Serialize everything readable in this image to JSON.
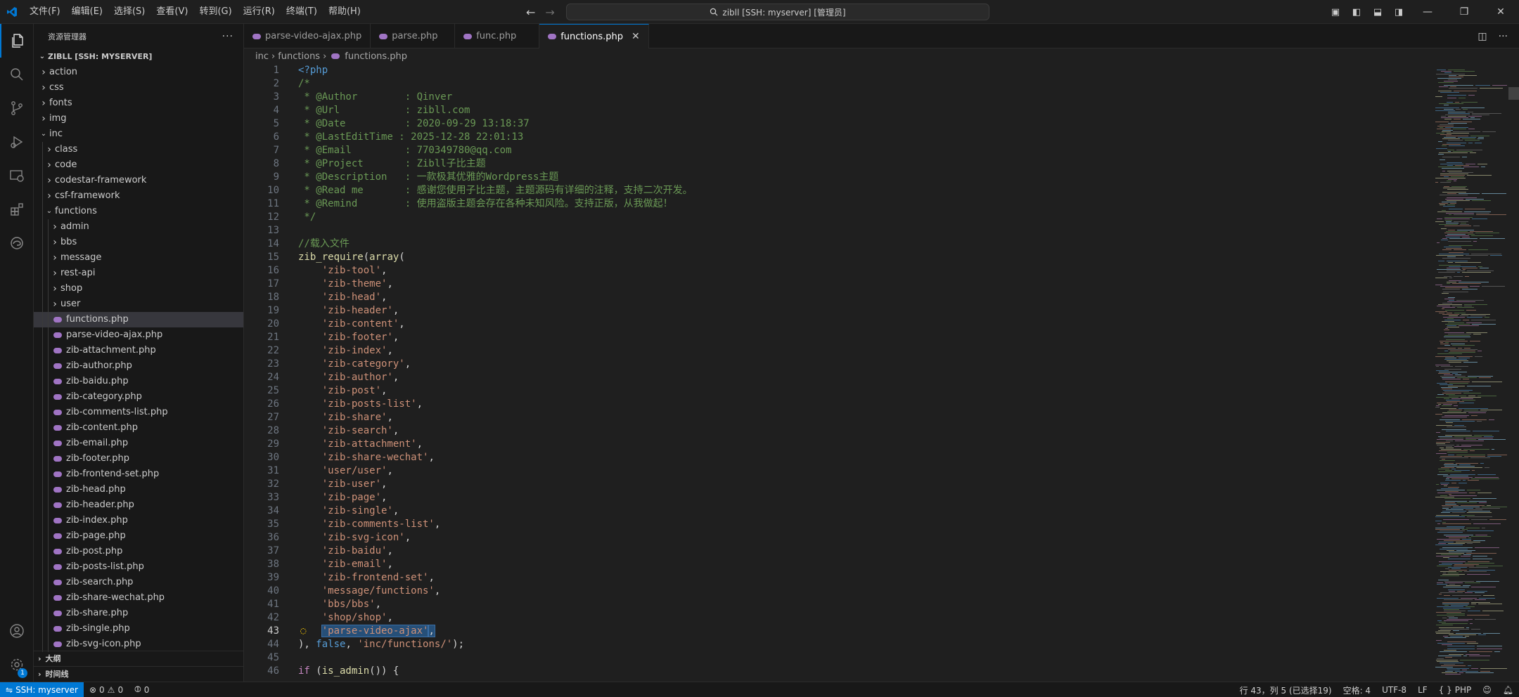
{
  "titlebar": {
    "menu": [
      "文件(F)",
      "编辑(E)",
      "选择(S)",
      "查看(V)",
      "转到(G)",
      "运行(R)",
      "终端(T)",
      "帮助(H)"
    ],
    "command_center": "zibll [SSH: myserver] [管理员]",
    "back_arrow": "←",
    "forward_arrow": "→"
  },
  "sidebar": {
    "header": "资源管理器",
    "more": "···",
    "workspace": "ZIBLL [SSH: MYSERVER]",
    "tree": [
      {
        "label": "action",
        "type": "folder",
        "depth": 0,
        "open": false
      },
      {
        "label": "css",
        "type": "folder",
        "depth": 0,
        "open": false
      },
      {
        "label": "fonts",
        "type": "folder",
        "depth": 0,
        "open": false
      },
      {
        "label": "img",
        "type": "folder",
        "depth": 0,
        "open": false
      },
      {
        "label": "inc",
        "type": "folder",
        "depth": 0,
        "open": true
      },
      {
        "label": "class",
        "type": "folder",
        "depth": 1,
        "open": false
      },
      {
        "label": "code",
        "type": "folder",
        "depth": 1,
        "open": false
      },
      {
        "label": "codestar-framework",
        "type": "folder",
        "depth": 1,
        "open": false
      },
      {
        "label": "csf-framework",
        "type": "folder",
        "depth": 1,
        "open": false
      },
      {
        "label": "functions",
        "type": "folder",
        "depth": 1,
        "open": true
      },
      {
        "label": "admin",
        "type": "folder",
        "depth": 2,
        "open": false
      },
      {
        "label": "bbs",
        "type": "folder",
        "depth": 2,
        "open": false
      },
      {
        "label": "message",
        "type": "folder",
        "depth": 2,
        "open": false
      },
      {
        "label": "rest-api",
        "type": "folder",
        "depth": 2,
        "open": false
      },
      {
        "label": "shop",
        "type": "folder",
        "depth": 2,
        "open": false
      },
      {
        "label": "user",
        "type": "folder",
        "depth": 2,
        "open": false
      },
      {
        "label": "functions.php",
        "type": "php",
        "depth": 2,
        "selected": true
      },
      {
        "label": "parse-video-ajax.php",
        "type": "php",
        "depth": 2
      },
      {
        "label": "zib-attachment.php",
        "type": "php",
        "depth": 2
      },
      {
        "label": "zib-author.php",
        "type": "php",
        "depth": 2
      },
      {
        "label": "zib-baidu.php",
        "type": "php",
        "depth": 2
      },
      {
        "label": "zib-category.php",
        "type": "php",
        "depth": 2
      },
      {
        "label": "zib-comments-list.php",
        "type": "php",
        "depth": 2
      },
      {
        "label": "zib-content.php",
        "type": "php",
        "depth": 2
      },
      {
        "label": "zib-email.php",
        "type": "php",
        "depth": 2
      },
      {
        "label": "zib-footer.php",
        "type": "php",
        "depth": 2
      },
      {
        "label": "zib-frontend-set.php",
        "type": "php",
        "depth": 2
      },
      {
        "label": "zib-head.php",
        "type": "php",
        "depth": 2
      },
      {
        "label": "zib-header.php",
        "type": "php",
        "depth": 2
      },
      {
        "label": "zib-index.php",
        "type": "php",
        "depth": 2
      },
      {
        "label": "zib-page.php",
        "type": "php",
        "depth": 2
      },
      {
        "label": "zib-post.php",
        "type": "php",
        "depth": 2
      },
      {
        "label": "zib-posts-list.php",
        "type": "php",
        "depth": 2
      },
      {
        "label": "zib-search.php",
        "type": "php",
        "depth": 2
      },
      {
        "label": "zib-share-wechat.php",
        "type": "php",
        "depth": 2
      },
      {
        "label": "zib-share.php",
        "type": "php",
        "depth": 2
      },
      {
        "label": "zib-single.php",
        "type": "php",
        "depth": 2
      },
      {
        "label": "zib-svg-icon.php",
        "type": "php",
        "depth": 2
      }
    ],
    "outline": "大纲",
    "timeline": "时间线"
  },
  "activity_badge": "1",
  "tabs": [
    {
      "label": "parse-video-ajax.php",
      "active": false
    },
    {
      "label": "parse.php",
      "active": false
    },
    {
      "label": "func.php",
      "active": false
    },
    {
      "label": "functions.php",
      "active": true
    }
  ],
  "breadcrumb": [
    "inc",
    "functions",
    "functions.php"
  ],
  "code_lines": [
    [
      [
        "c-tag",
        "<?php"
      ]
    ],
    [
      [
        "c-comment",
        "/*"
      ]
    ],
    [
      [
        "c-comment",
        " * @Author        : Qinver"
      ]
    ],
    [
      [
        "c-comment",
        " * @Url           : zibll.com"
      ]
    ],
    [
      [
        "c-comment",
        " * @Date          : 2020-09-29 13:18:37"
      ]
    ],
    [
      [
        "c-comment",
        " * @LastEditTime : 2025-12-28 22:01:13"
      ]
    ],
    [
      [
        "c-comment",
        " * @Email         : 770349780@qq.com"
      ]
    ],
    [
      [
        "c-comment",
        " * @Project       : Zibll子比主题"
      ]
    ],
    [
      [
        "c-comment",
        " * @Description   : 一款极其优雅的Wordpress主题"
      ]
    ],
    [
      [
        "c-comment",
        " * @Read me       : 感谢您使用子比主题，主题源码有详细的注释，支持二次开发。"
      ]
    ],
    [
      [
        "c-comment",
        " * @Remind        : 使用盗版主题会存在各种未知风险。支持正版，从我做起！"
      ]
    ],
    [
      [
        "c-comment",
        " */"
      ]
    ],
    [
      [
        "c-plain",
        ""
      ]
    ],
    [
      [
        "c-comment",
        "//载入文件"
      ]
    ],
    [
      [
        "c-fn",
        "zib_require"
      ],
      [
        "c-plain",
        "("
      ],
      [
        "c-fn",
        "array"
      ],
      [
        "c-plain",
        "("
      ]
    ],
    [
      [
        "c-plain",
        "    "
      ],
      [
        "c-str",
        "'zib-tool'"
      ],
      [
        "c-plain",
        ","
      ]
    ],
    [
      [
        "c-plain",
        "    "
      ],
      [
        "c-str",
        "'zib-theme'"
      ],
      [
        "c-plain",
        ","
      ]
    ],
    [
      [
        "c-plain",
        "    "
      ],
      [
        "c-str",
        "'zib-head'"
      ],
      [
        "c-plain",
        ","
      ]
    ],
    [
      [
        "c-plain",
        "    "
      ],
      [
        "c-str",
        "'zib-header'"
      ],
      [
        "c-plain",
        ","
      ]
    ],
    [
      [
        "c-plain",
        "    "
      ],
      [
        "c-str",
        "'zib-content'"
      ],
      [
        "c-plain",
        ","
      ]
    ],
    [
      [
        "c-plain",
        "    "
      ],
      [
        "c-str",
        "'zib-footer'"
      ],
      [
        "c-plain",
        ","
      ]
    ],
    [
      [
        "c-plain",
        "    "
      ],
      [
        "c-str",
        "'zib-index'"
      ],
      [
        "c-plain",
        ","
      ]
    ],
    [
      [
        "c-plain",
        "    "
      ],
      [
        "c-str",
        "'zib-category'"
      ],
      [
        "c-plain",
        ","
      ]
    ],
    [
      [
        "c-plain",
        "    "
      ],
      [
        "c-str",
        "'zib-author'"
      ],
      [
        "c-plain",
        ","
      ]
    ],
    [
      [
        "c-plain",
        "    "
      ],
      [
        "c-str",
        "'zib-post'"
      ],
      [
        "c-plain",
        ","
      ]
    ],
    [
      [
        "c-plain",
        "    "
      ],
      [
        "c-str",
        "'zib-posts-list'"
      ],
      [
        "c-plain",
        ","
      ]
    ],
    [
      [
        "c-plain",
        "    "
      ],
      [
        "c-str",
        "'zib-share'"
      ],
      [
        "c-plain",
        ","
      ]
    ],
    [
      [
        "c-plain",
        "    "
      ],
      [
        "c-str",
        "'zib-search'"
      ],
      [
        "c-plain",
        ","
      ]
    ],
    [
      [
        "c-plain",
        "    "
      ],
      [
        "c-str",
        "'zib-attachment'"
      ],
      [
        "c-plain",
        ","
      ]
    ],
    [
      [
        "c-plain",
        "    "
      ],
      [
        "c-str",
        "'zib-share-wechat'"
      ],
      [
        "c-plain",
        ","
      ]
    ],
    [
      [
        "c-plain",
        "    "
      ],
      [
        "c-str",
        "'user/user'"
      ],
      [
        "c-plain",
        ","
      ]
    ],
    [
      [
        "c-plain",
        "    "
      ],
      [
        "c-str",
        "'zib-user'"
      ],
      [
        "c-plain",
        ","
      ]
    ],
    [
      [
        "c-plain",
        "    "
      ],
      [
        "c-str",
        "'zib-page'"
      ],
      [
        "c-plain",
        ","
      ]
    ],
    [
      [
        "c-plain",
        "    "
      ],
      [
        "c-str",
        "'zib-single'"
      ],
      [
        "c-plain",
        ","
      ]
    ],
    [
      [
        "c-plain",
        "    "
      ],
      [
        "c-str",
        "'zib-comments-list'"
      ],
      [
        "c-plain",
        ","
      ]
    ],
    [
      [
        "c-plain",
        "    "
      ],
      [
        "c-str",
        "'zib-svg-icon'"
      ],
      [
        "c-plain",
        ","
      ]
    ],
    [
      [
        "c-plain",
        "    "
      ],
      [
        "c-str",
        "'zib-baidu'"
      ],
      [
        "c-plain",
        ","
      ]
    ],
    [
      [
        "c-plain",
        "    "
      ],
      [
        "c-str",
        "'zib-email'"
      ],
      [
        "c-plain",
        ","
      ]
    ],
    [
      [
        "c-plain",
        "    "
      ],
      [
        "c-str",
        "'zib-frontend-set'"
      ],
      [
        "c-plain",
        ","
      ]
    ],
    [
      [
        "c-plain",
        "    "
      ],
      [
        "c-str",
        "'message/functions'"
      ],
      [
        "c-plain",
        ","
      ]
    ],
    [
      [
        "c-plain",
        "    "
      ],
      [
        "c-str",
        "'bbs/bbs'"
      ],
      [
        "c-plain",
        ","
      ]
    ],
    [
      [
        "c-plain",
        "    "
      ],
      [
        "c-str",
        "'shop/shop'"
      ],
      [
        "c-plain",
        ","
      ]
    ],
    [
      [
        "c-plain",
        "    "
      ],
      [
        "c-str sel",
        "'parse-video-ajax'"
      ],
      [
        "c-plain sel",
        ","
      ]
    ],
    [
      [
        "c-plain",
        "), "
      ],
      [
        "c-const",
        "false"
      ],
      [
        "c-plain",
        ", "
      ],
      [
        "c-str",
        "'inc/functions/'"
      ],
      [
        "c-plain",
        ");"
      ]
    ],
    [
      [
        "c-plain",
        ""
      ]
    ],
    [
      [
        "c-kw",
        "if"
      ],
      [
        "c-plain",
        " ("
      ],
      [
        "c-fn",
        "is_admin"
      ],
      [
        "c-plain",
        "()) {"
      ]
    ]
  ],
  "current_line": 43,
  "statusbar": {
    "remote": "SSH: myserver",
    "errors": "0",
    "warnings": "0",
    "ports": "0",
    "cursor": "行 43，列 5 (已选择19)",
    "spaces": "空格: 4",
    "encoding": "UTF-8",
    "eol": "LF",
    "language": "PHP",
    "language_braces": "{ }"
  },
  "colors": {
    "accent": "#0078d4",
    "php_icon": "#a074c4",
    "comment": "#6a9955",
    "string": "#ce9178"
  }
}
